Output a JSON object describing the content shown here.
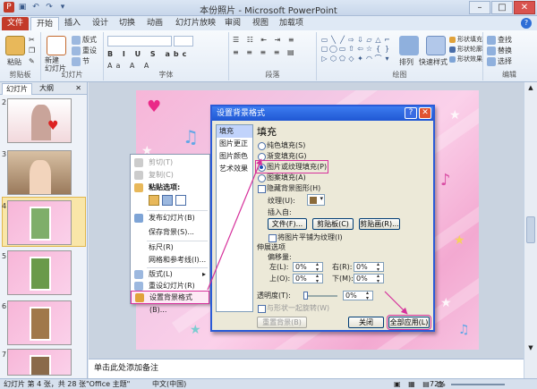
{
  "app": {
    "title": "本份照片 - Microsoft PowerPoint",
    "qat": [
      "save-icon",
      "undo-icon",
      "redo-icon",
      "customize-icon"
    ]
  },
  "tabs": [
    {
      "label": "文件"
    },
    {
      "label": "开始"
    },
    {
      "label": "插入"
    },
    {
      "label": "设计"
    },
    {
      "label": "切换"
    },
    {
      "label": "动画"
    },
    {
      "label": "幻灯片放映"
    },
    {
      "label": "审阅"
    },
    {
      "label": "视图"
    },
    {
      "label": "加载项"
    }
  ],
  "ribbon": {
    "paste": "粘贴",
    "new_slide": "新建\n幻灯片",
    "layout": "版式",
    "reset": "重设",
    "section": "节",
    "groups": {
      "clipboard": "剪贴板",
      "slides": "幻灯片",
      "font": "字体",
      "paragraph": "段落",
      "drawing": "绘图",
      "editing": "编辑"
    },
    "arrange": "排列",
    "quick_styles": "快速样式",
    "shape_fill": "形状填充",
    "shape_outline": "形状轮廓",
    "shape_effects": "形状效果",
    "find": "查找",
    "replace": "替换",
    "select": "选择"
  },
  "pane": {
    "tabs": [
      "幻灯片",
      "大纲"
    ],
    "slide_numbers": [
      "2",
      "3",
      "4",
      "5",
      "6",
      "7"
    ]
  },
  "context_menu": {
    "items": [
      {
        "label": "剪切(T)",
        "disabled": true
      },
      {
        "label": "复制(C)",
        "disabled": true
      },
      {
        "label": "粘贴选项:",
        "disabled": false
      },
      {
        "label": "发布幻灯片(B)",
        "disabled": false
      },
      {
        "label": "保存背景(S)...",
        "disabled": false
      },
      {
        "label": "标尺(R)",
        "disabled": false
      },
      {
        "label": "网格和参考线(I)...",
        "disabled": false
      },
      {
        "label": "版式(L)",
        "disabled": false
      },
      {
        "label": "重设幻灯片(R)",
        "disabled": false
      },
      {
        "label": "设置背景格式(B)...",
        "disabled": false
      }
    ]
  },
  "dialog": {
    "title": "设置背景格式",
    "help": "?",
    "close": "✕",
    "categories": [
      "填充",
      "图片更正",
      "图片颜色",
      "艺术效果"
    ],
    "heading": "填充",
    "fill_options": [
      "纯色填充(S)",
      "渐变填充(G)",
      "图片或纹理填充(P)",
      "图案填充(A)"
    ],
    "hide_bg": "隐藏背景图形(H)",
    "texture_label": "纹理(U):",
    "insert_from": "插入自:",
    "btn_file": "文件(F)...",
    "btn_clipboard": "剪贴板(C)",
    "btn_clipart": "剪贴画(R)...",
    "tile": "将图片平铺为纹理(I)",
    "stretch": "伸展选项",
    "offset": "偏移量:",
    "left": "左(L):",
    "right": "右(R):",
    "top": "上(O):",
    "bottom": "下(M):",
    "left_val": "0%",
    "right_val": "0%",
    "top_val": "0%",
    "bottom_val": "0%",
    "transparency": "透明度(T):",
    "transparency_val": "0%",
    "rotate_with": "与形状一起旋转(W)",
    "btn_reset": "重置背景(B)",
    "btn_close": "关闭",
    "btn_apply_all": "全部应用(L)"
  },
  "notes": "单击此处添加备注",
  "status": {
    "slide": "幻灯片 第 4 张，共 28 张",
    "theme": "\"Office 主题\"",
    "lang": "中文(中国)",
    "zoom": "72%"
  },
  "colors": {
    "accent": "#d6309b",
    "dialog_title": "#1f57d3",
    "file_tab": "#c33b2a"
  }
}
